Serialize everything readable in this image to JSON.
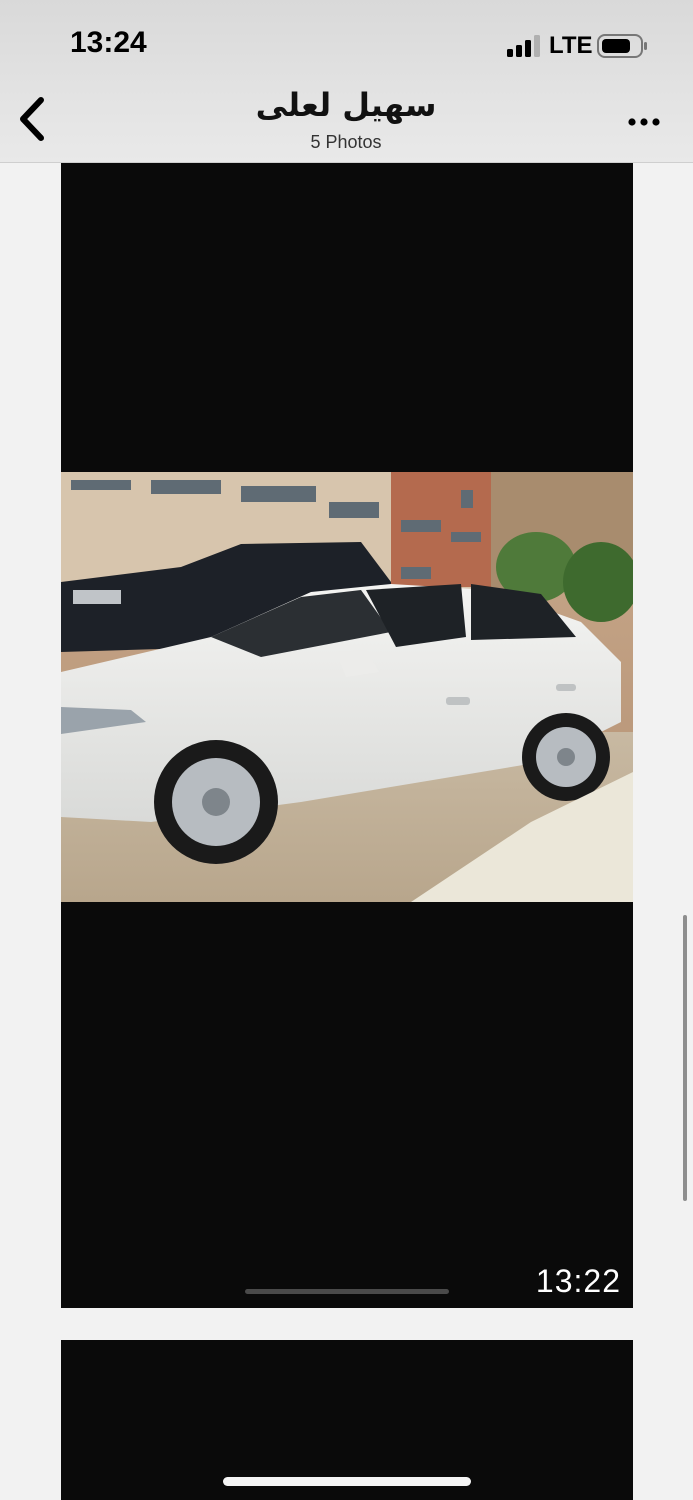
{
  "status_bar": {
    "time": "13:24",
    "network": "LTE",
    "signal_icon": "signal-icon",
    "battery_icon": "battery-icon"
  },
  "header": {
    "title": "سهیل لعلی",
    "subtitle": "5 Photos",
    "back_icon": "chevron-left-icon",
    "more_icon": "more-icon"
  },
  "photos": [
    {
      "timestamp": "13:22",
      "content": "white sedan photo"
    },
    {
      "timestamp": ""
    }
  ],
  "colors": {
    "photo_background": "#0a0a0a",
    "page_background": "#f2f2f2"
  }
}
